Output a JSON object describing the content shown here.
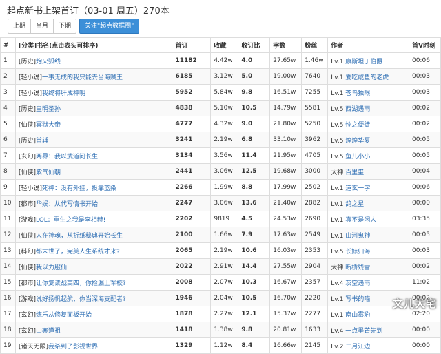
{
  "page": {
    "title": "起点新书上架首订（03-01 周五）270本"
  },
  "toolbar": {
    "buttons": [
      "上期",
      "当月",
      "下期"
    ],
    "primary": "关注\"起点数据圈\""
  },
  "table": {
    "headers": [
      "#",
      "[分类]书名(点击表头可排序)",
      "首订",
      "收藏",
      "收订比",
      "字数",
      "粉丝",
      "作者",
      "首V时刻"
    ],
    "rows": [
      {
        "n": "1",
        "cat": "[历史]",
        "book": "炮火弧线",
        "first": "11182",
        "fav": "4.42w",
        "ratio": "4.0",
        "words": "27.65w",
        "fans": "1.46w",
        "lv": "Lv.1",
        "author": "康斯坦丁伯爵",
        "time": "00:06"
      },
      {
        "n": "2",
        "cat": "[轻小说]",
        "book": "一事无成的我只能去当海贼王",
        "first": "6185",
        "fav": "3.12w",
        "ratio": "5.0",
        "words": "19.00w",
        "fans": "7640",
        "lv": "Lv.1",
        "author": "爱吃咸鱼的老虎",
        "time": "00:03"
      },
      {
        "n": "3",
        "cat": "[轻小说]",
        "book": "我终将肝成神明",
        "first": "5952",
        "fav": "5.84w",
        "ratio": "9.8",
        "words": "16.51w",
        "fans": "7255",
        "lv": "Lv.1",
        "author": "苍鸟独眼",
        "time": "00:03"
      },
      {
        "n": "4",
        "cat": "[历史]",
        "book": "皇明圣孙",
        "first": "4838",
        "fav": "5.10w",
        "ratio": "10.5",
        "words": "14.79w",
        "fans": "5581",
        "lv": "Lv.5",
        "author": "西湖遇雨",
        "time": "00:02"
      },
      {
        "n": "5",
        "cat": "[仙侠]",
        "book": "冥狱大帝",
        "first": "4777",
        "fav": "4.32w",
        "ratio": "9.0",
        "words": "21.80w",
        "fans": "5250",
        "lv": "Lv.5",
        "author": "怜之便徒",
        "time": "00:02"
      },
      {
        "n": "6",
        "cat": "[历史]",
        "book": "首辅",
        "first": "3241",
        "fav": "2.19w",
        "ratio": "6.8",
        "words": "33.10w",
        "fans": "3962",
        "lv": "Lv.5",
        "author": "煌煌华夏",
        "time": "00:05"
      },
      {
        "n": "7",
        "cat": "[玄幻]",
        "book": "两界：我以武道问长生",
        "first": "3134",
        "fav": "3.56w",
        "ratio": "11.4",
        "words": "21.95w",
        "fans": "4705",
        "lv": "Lv.5",
        "author": "鱼儿小小",
        "time": "00:05"
      },
      {
        "n": "8",
        "cat": "[仙侠]",
        "book": "紫气仙朝",
        "first": "2441",
        "fav": "3.06w",
        "ratio": "12.5",
        "words": "19.68w",
        "fans": "3000",
        "lv": "大神",
        "author": "百里玺",
        "time": "00:04"
      },
      {
        "n": "9",
        "cat": "[轻小说]",
        "book": "死神：没有外挂，投靠蓝染",
        "first": "2266",
        "fav": "1.99w",
        "ratio": "8.8",
        "words": "17.99w",
        "fans": "2502",
        "lv": "Lv.1",
        "author": "道玄一字",
        "time": "00:06"
      },
      {
        "n": "10",
        "cat": "[都市]",
        "book": "华娱：从代写情书开始",
        "first": "2247",
        "fav": "3.06w",
        "ratio": "13.6",
        "words": "21.40w",
        "fans": "2882",
        "lv": "Lv.1",
        "author": "鸽之星",
        "time": "00:00"
      },
      {
        "n": "11",
        "cat": "[游戏]",
        "book": "LOL：重生之我是李相赫!",
        "first": "2202",
        "fav": "9819",
        "ratio": "4.5",
        "words": "24.53w",
        "fans": "2690",
        "lv": "Lv.1",
        "author": "真不是闲人",
        "time": "03:35"
      },
      {
        "n": "12",
        "cat": "[仙侠]",
        "book": "人在神魂，从折纸秘典开始长生",
        "first": "2100",
        "fav": "1.66w",
        "ratio": "7.9",
        "words": "17.63w",
        "fans": "2549",
        "lv": "Lv.1",
        "author": "山河鬼神",
        "time": "00:05"
      },
      {
        "n": "13",
        "cat": "[科幻]",
        "book": "都末世了，完美人生系统才来?",
        "first": "2065",
        "fav": "2.19w",
        "ratio": "10.6",
        "words": "16.03w",
        "fans": "2353",
        "lv": "Lv.5",
        "author": "长鲸归海",
        "time": "00:03"
      },
      {
        "n": "14",
        "cat": "[仙侠]",
        "book": "我以力服仙",
        "first": "2022",
        "fav": "2.91w",
        "ratio": "14.4",
        "words": "27.55w",
        "fans": "2904",
        "lv": "大神",
        "author": "断桥残雪",
        "time": "00:02"
      },
      {
        "n": "15",
        "cat": "[都市]",
        "book": "让你复读战高四，你捡漏上军校?",
        "first": "2008",
        "fav": "2.07w",
        "ratio": "10.3",
        "words": "16.67w",
        "fans": "2357",
        "lv": "Lv.4",
        "author": "灰空遇雨",
        "time": "11:02"
      },
      {
        "n": "16",
        "cat": "[游戏]",
        "book": "说好扬帆起航，你当深海支配者?",
        "first": "1946",
        "fav": "2.04w",
        "ratio": "10.5",
        "words": "16.70w",
        "fans": "2220",
        "lv": "Lv.1",
        "author": "写书的喵",
        "time": "00:02"
      },
      {
        "n": "17",
        "cat": "[玄幻]",
        "book": "炼乐从修复面板开始",
        "first": "1878",
        "fav": "2.27w",
        "ratio": "12.1",
        "words": "15.37w",
        "fans": "2277",
        "lv": "Lv.1",
        "author": "南山雾豹",
        "time": "02:20"
      },
      {
        "n": "18",
        "cat": "[玄幻]",
        "book": "山寨道祖",
        "first": "1418",
        "fav": "1.38w",
        "ratio": "9.8",
        "words": "20.81w",
        "fans": "1633",
        "lv": "Lv.4",
        "author": "一点墨芒先到",
        "time": "00:00"
      },
      {
        "n": "19",
        "cat": "[诸天无限]",
        "book": "我杀到了影视世界",
        "first": "1329",
        "fav": "1.12w",
        "ratio": "8.4",
        "words": "16.66w",
        "fans": "2145",
        "lv": "Lv.2",
        "author": "二月江边",
        "time": "00:00"
      }
    ]
  },
  "watermark": "文儿大宅"
}
